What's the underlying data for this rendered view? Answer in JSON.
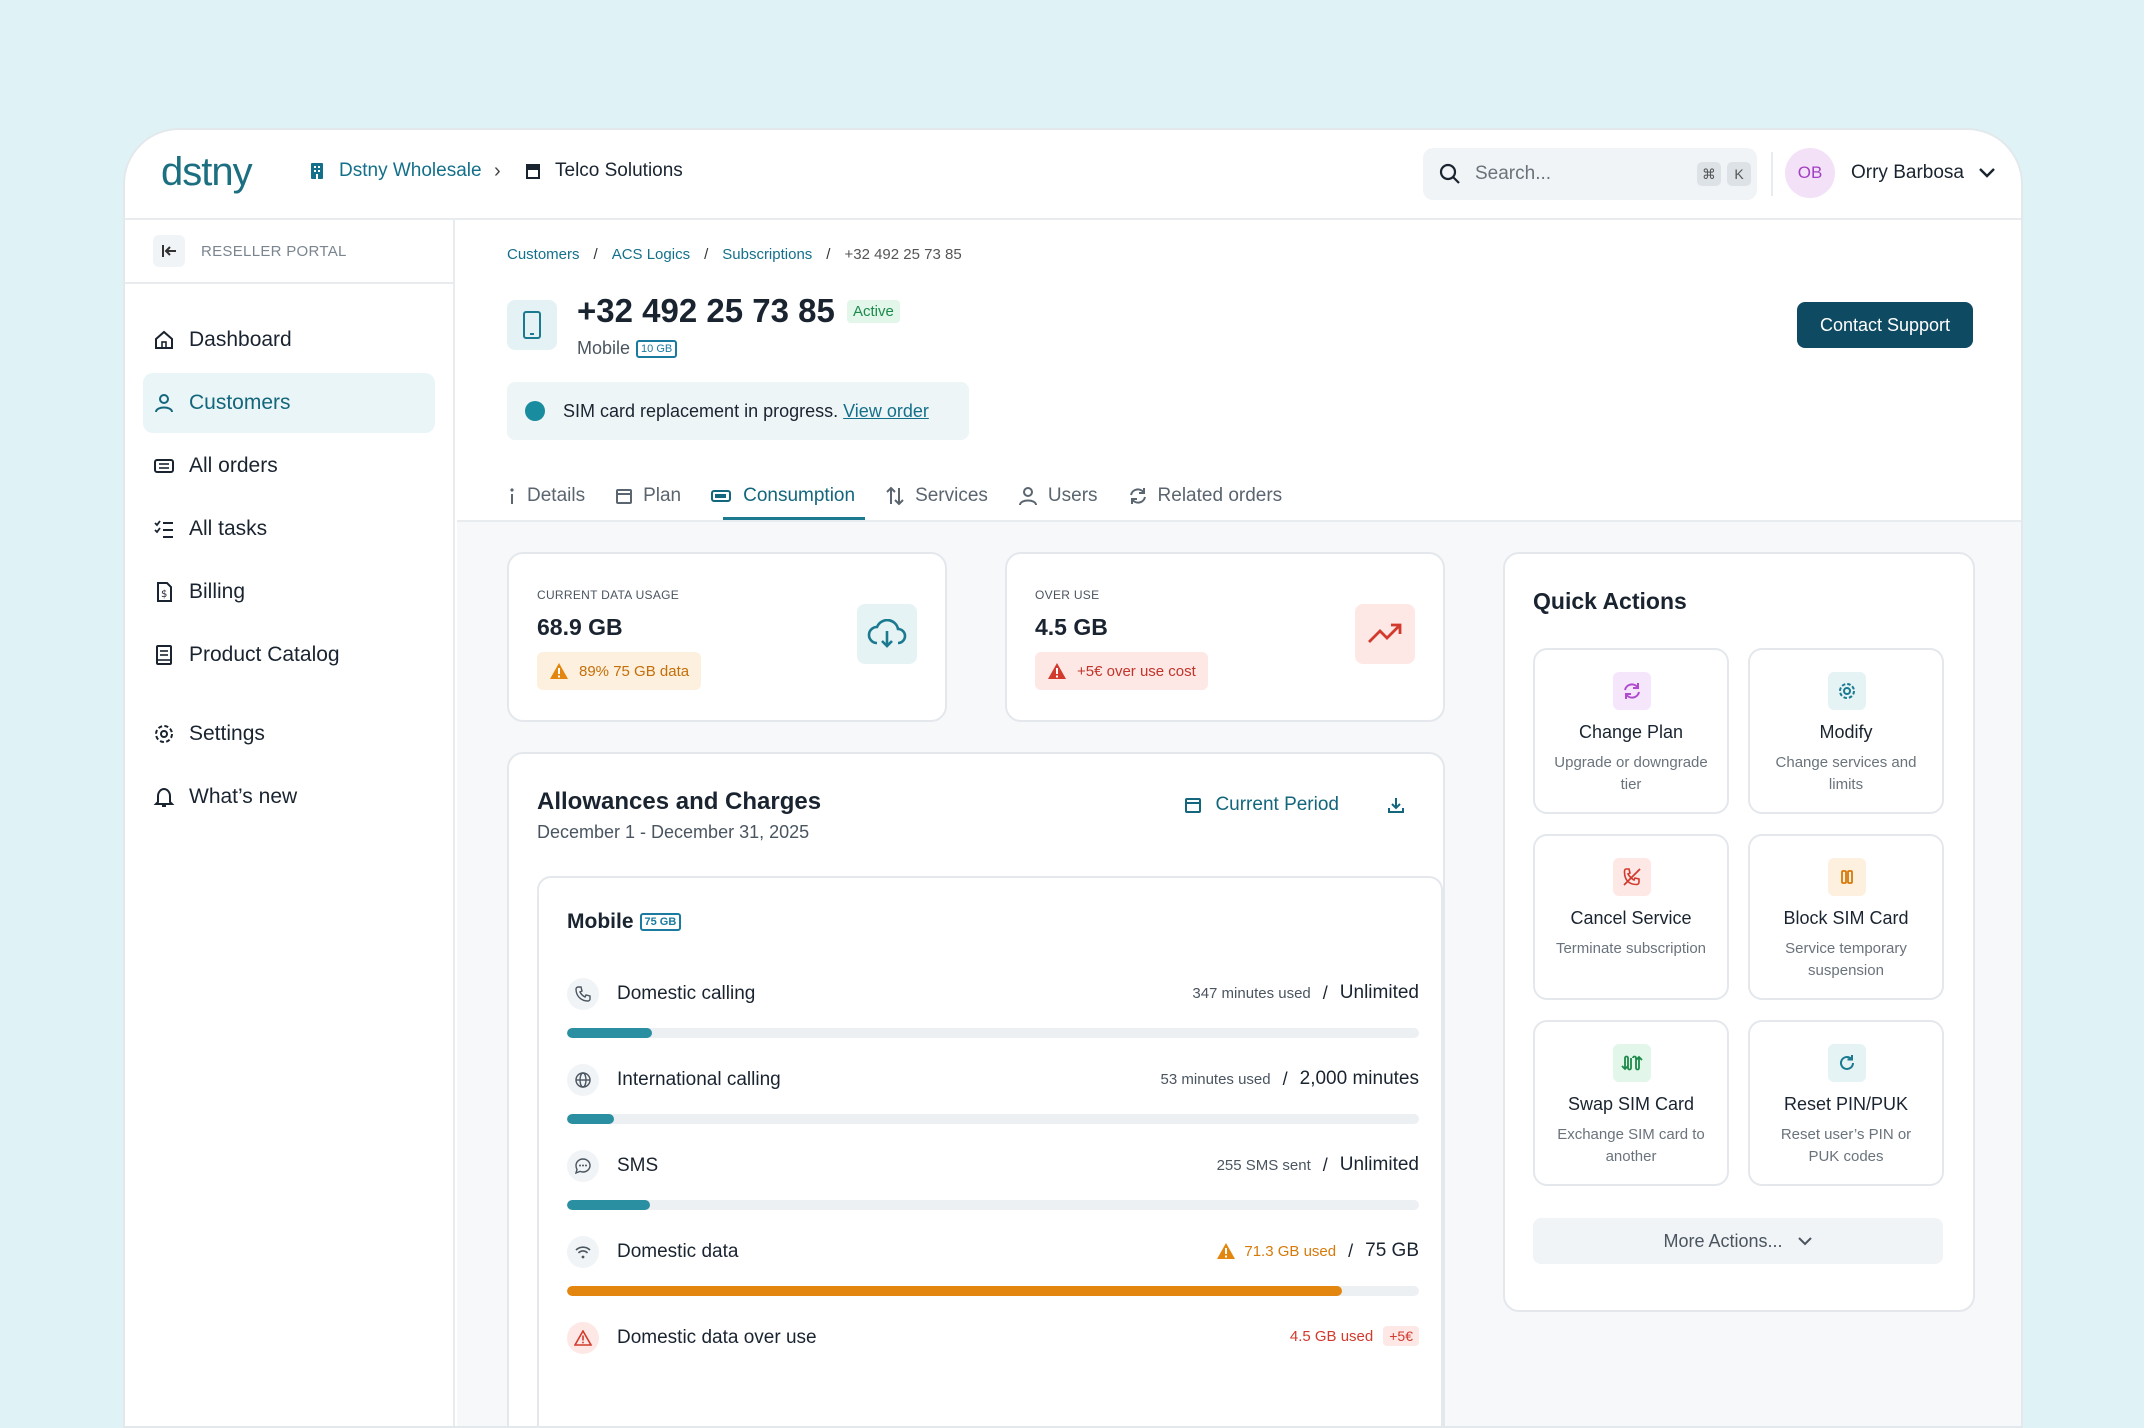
{
  "app": {
    "logo": "dstny",
    "org_primary": "Dstny Wholesale",
    "org_secondary": "Telco Solutions",
    "search_placeholder": "Search...",
    "shortcut_cmd": "⌘",
    "shortcut_key": "K",
    "user_initials": "OB",
    "user_name": "Orry Barbosa"
  },
  "sidebar": {
    "portal_label": "RESELLER PORTAL",
    "items": [
      {
        "label": "Dashboard",
        "icon": "home-icon"
      },
      {
        "label": "Customers",
        "icon": "user-icon",
        "active": true
      },
      {
        "label": "All orders",
        "icon": "orders-icon"
      },
      {
        "label": "All tasks",
        "icon": "tasks-icon"
      },
      {
        "label": "Billing",
        "icon": "billing-icon"
      },
      {
        "label": "Product Catalog",
        "icon": "catalog-icon"
      }
    ],
    "secondary_items": [
      {
        "label": "Settings",
        "icon": "gear-icon"
      },
      {
        "label": "What’s new",
        "icon": "bell-icon"
      }
    ]
  },
  "breadcrumb": {
    "items": [
      "Customers",
      "ACS Logics",
      "Subscriptions"
    ],
    "current": "+32 492 25 73 85",
    "separator": "/"
  },
  "header": {
    "title": "+32 492 25 73 85",
    "status": "Active",
    "type": "Mobile",
    "plan_tag": "10 GB",
    "contact_button": "Contact Support"
  },
  "notice": {
    "text": "SIM card replacement in progress.",
    "link": "View order"
  },
  "tabs": [
    {
      "label": "Details",
      "icon": "info-icon"
    },
    {
      "label": "Plan",
      "icon": "calendar-icon"
    },
    {
      "label": "Consumption",
      "icon": "battery-icon",
      "active": true
    },
    {
      "label": "Services",
      "icon": "sort-arrows-icon"
    },
    {
      "label": "Users",
      "icon": "user-icon"
    },
    {
      "label": "Related orders",
      "icon": "refresh-icon"
    }
  ],
  "kpis": {
    "usage": {
      "label": "CURRENT DATA USAGE",
      "value": "68.9 GB",
      "pill": "89% 75 GB data"
    },
    "overuse": {
      "label": "OVER USE",
      "value": "4.5 GB",
      "pill": "+5€ over use cost"
    }
  },
  "allowances": {
    "title": "Allowances and Charges",
    "period_text": "December 1 - December 31, 2025",
    "period_button": "Current Period",
    "mobile_title": "Mobile",
    "mobile_tag": "75 GB",
    "rows": [
      {
        "label": "Domestic calling",
        "used": "347 minutes used",
        "limit": "Unlimited",
        "fill": 0.1,
        "color": "#2a8fa0"
      },
      {
        "label": "International calling",
        "used": "53 minutes used",
        "limit": "2,000 minutes",
        "fill": 0.055,
        "color": "#2a8fa0"
      },
      {
        "label": "SMS",
        "used": "255 SMS sent",
        "limit": "Unlimited",
        "fill": 0.097,
        "color": "#2a8fa0"
      },
      {
        "label": "Domestic data",
        "used": "71.3 GB used",
        "limit": "75 GB",
        "fill": 0.91,
        "color": "#e3860f"
      },
      {
        "label": "Domestic data over use",
        "used": "4.5 GB used",
        "limit": "+5€"
      }
    ],
    "separator": "/"
  },
  "quick_actions": {
    "title": "Quick Actions",
    "items": [
      {
        "title": "Change Plan",
        "desc": "Upgrade or downgrade tier",
        "bg": "#f6e6fb",
        "fg": "#b04ad0"
      },
      {
        "title": "Modify",
        "desc": "Change services and limits",
        "bg": "#e5f3f5",
        "fg": "#1b7a90"
      },
      {
        "title": "Cancel Service",
        "desc": "Terminate subscription",
        "bg": "#fde8e6",
        "fg": "#d13a2c"
      },
      {
        "title": "Block SIM Card",
        "desc": "Service temporary suspension",
        "bg": "#fdf0de",
        "fg": "#d67a0a"
      },
      {
        "title": "Swap SIM Card",
        "desc": "Exchange SIM card to another",
        "bg": "#e2f6ea",
        "fg": "#1c8a4a"
      },
      {
        "title": "Reset PIN/PUK",
        "desc": "Reset user’s PIN or PUK codes",
        "bg": "#e5f3f5",
        "fg": "#1b7a90"
      }
    ],
    "more": "More Actions..."
  }
}
